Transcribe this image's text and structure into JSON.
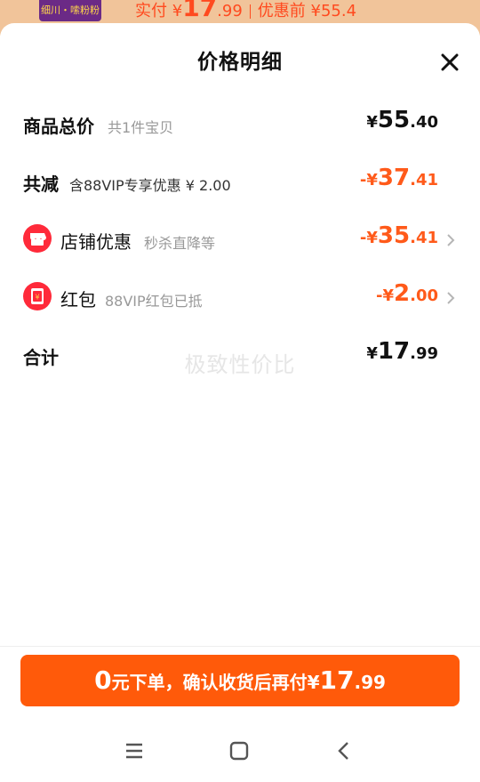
{
  "backdrop": {
    "thumb_text": "细川・嗦粉粉",
    "price_prefix": "实付 ¥",
    "price_int": "17",
    "price_dec": ".99",
    "before_label": "优惠前 ¥55.4"
  },
  "sheet": {
    "title": "价格明细"
  },
  "rows": {
    "total": {
      "label": "商品总价",
      "sub": "共1件宝贝",
      "currency": "¥",
      "int": "55",
      "dec": ".40"
    },
    "reduce": {
      "label": "共减",
      "sub": "含88VIP专享优惠 ¥ 2.00",
      "currency": "-¥",
      "int": "37",
      "dec": ".41"
    },
    "shop": {
      "label": "店铺优惠",
      "sub": "秒杀直降等",
      "currency": "-¥",
      "int": "35",
      "dec": ".41"
    },
    "redpacket": {
      "label": "红包",
      "sub": "88VIP红包已抵",
      "currency": "-¥",
      "int": "2",
      "dec": ".00"
    },
    "sum": {
      "label": "合计",
      "currency": "¥",
      "int": "17",
      "dec": ".99"
    }
  },
  "watermark": "极致性价比",
  "cta": {
    "zero": "0",
    "text": "元下单，确认收货后再付",
    "currency": "¥",
    "int": "17",
    "dec": ".99"
  },
  "colors": {
    "accent": "#ff5a0a",
    "discount": "#ff5a1a",
    "icon_red": "#ff2a3a"
  },
  "icons": {
    "close": "close-icon",
    "shop": "shop-icon",
    "redpacket": "red-packet-icon",
    "chevron": "chevron-right-icon",
    "nav_menu": "menu-icon",
    "nav_home": "home-square-icon",
    "nav_back": "back-icon"
  }
}
